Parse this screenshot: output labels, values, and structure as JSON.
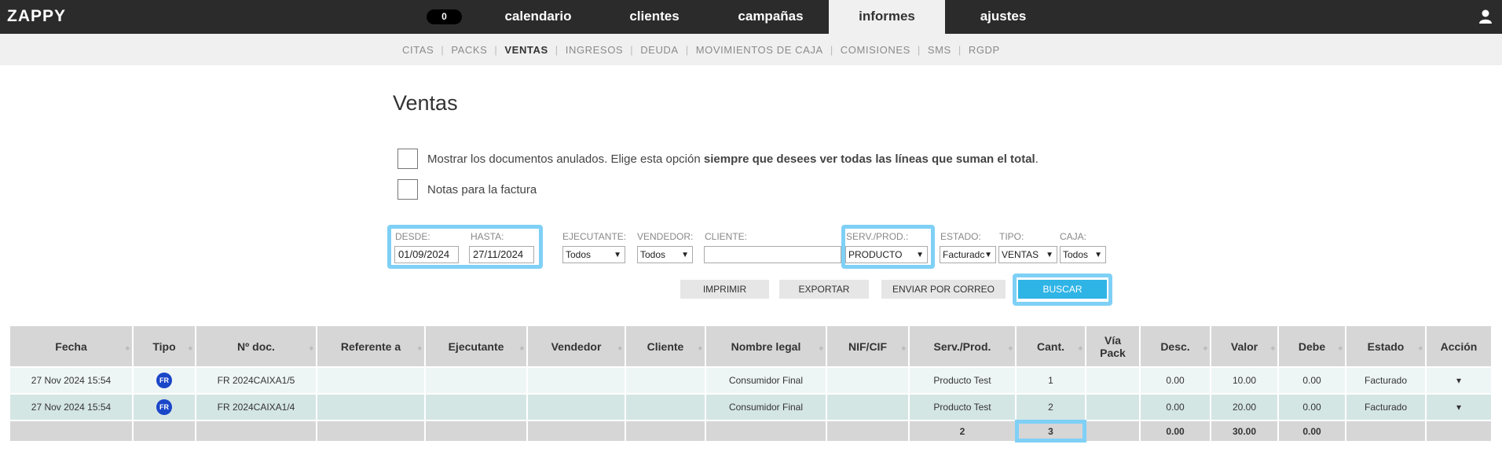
{
  "app": {
    "logo": "ZAPPY",
    "notification_count": "0"
  },
  "nav": [
    {
      "label": "calendario",
      "active": false
    },
    {
      "label": "clientes",
      "active": false
    },
    {
      "label": "campañas",
      "active": false
    },
    {
      "label": "informes",
      "active": true
    },
    {
      "label": "ajustes",
      "active": false
    }
  ],
  "subnav": [
    "CITAS",
    "PACKS",
    "VENTAS",
    "INGRESOS",
    "DEUDA",
    "MOVIMIENTOS DE CAJA",
    "COMISIONES",
    "SMS",
    "RGDP"
  ],
  "subnav_active": "VENTAS",
  "page": {
    "title": "Ventas"
  },
  "options": {
    "anulados_prefix": "Mostrar los documentos anulados. Elige esta opción ",
    "anulados_bold": "siempre que desees ver todas las líneas que suman el total",
    "anulados_suffix": ".",
    "notas_label": "Notas para la factura"
  },
  "filters": {
    "desde_label": "DESDE:",
    "desde_value": "01/09/2024",
    "hasta_label": "HASTA:",
    "hasta_value": "27/11/2024",
    "ejecutante_label": "EJECUTANTE:",
    "ejecutante_value": "Todos",
    "vendedor_label": "VENDEDOR:",
    "vendedor_value": "Todos",
    "cliente_label": "CLIENTE:",
    "cliente_value": "",
    "servprod_label": "SERV./PROD.:",
    "servprod_value": "PRODUCTO",
    "estado_label": "ESTADO:",
    "estado_value": "Facturadc",
    "tipo_label": "TIPO:",
    "tipo_value": "VENTAS",
    "caja_label": "CAJA:",
    "caja_value": "Todos"
  },
  "actions": {
    "imprimir": "IMPRIMIR",
    "exportar": "EXPORTAR",
    "enviar": "ENVIAR POR CORREO",
    "buscar": "BUSCAR"
  },
  "table": {
    "columns": [
      "Fecha",
      "Tipo",
      "Nº doc.",
      "Referente a",
      "Ejecutante",
      "Vendedor",
      "Cliente",
      "Nombre legal",
      "NIF/CIF",
      "Serv./Prod.",
      "Cant.",
      "Vía Pack",
      "Desc.",
      "Valor",
      "Debe",
      "Estado",
      "Acción"
    ],
    "rows": [
      {
        "fecha": "27 Nov 2024 15:54",
        "tipo": "FR",
        "doc": "FR 2024CAIXA1/5",
        "referente": "",
        "ejecutante": "",
        "vendedor": "",
        "cliente": "",
        "nombre_legal": "Consumidor Final",
        "nif": "",
        "servprod": "Producto Test",
        "cant": "1",
        "via_pack": "",
        "desc": "0.00",
        "valor": "10.00",
        "debe": "0.00",
        "estado": "Facturado",
        "accion": "▾"
      },
      {
        "fecha": "27 Nov 2024 15:54",
        "tipo": "FR",
        "doc": "FR 2024CAIXA1/4",
        "referente": "",
        "ejecutante": "",
        "vendedor": "",
        "cliente": "",
        "nombre_legal": "Consumidor Final",
        "nif": "",
        "servprod": "Producto Test",
        "cant": "2",
        "via_pack": "",
        "desc": "0.00",
        "valor": "20.00",
        "debe": "0.00",
        "estado": "Facturado",
        "accion": "▾"
      }
    ],
    "totals": {
      "servprod": "2",
      "cant": "3",
      "desc": "0.00",
      "valor": "30.00",
      "debe": "0.00"
    }
  },
  "colors": {
    "topbar": "#2b2b2b",
    "highlight": "#7fd0f6",
    "primary_button": "#2fb4e6",
    "fr_badge": "#1a46c8"
  },
  "icons": {
    "user": "user-icon",
    "select_arrow": "chevron-down-icon"
  }
}
